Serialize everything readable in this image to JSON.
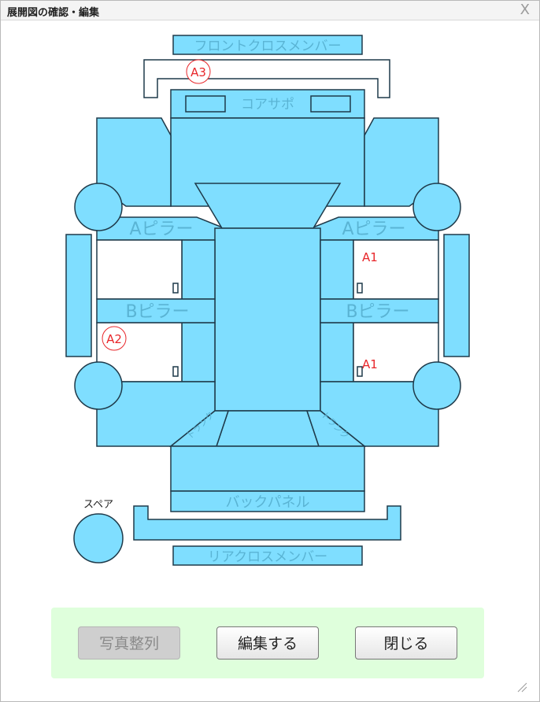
{
  "window": {
    "title": "展開図の確認・編集",
    "close_glyph": "X"
  },
  "panels": {
    "front_cross_member": "フロントクロスメンバー",
    "core_support": "コアサポ",
    "a_pillar_left": "Aピラー",
    "a_pillar_right": "Aピラー",
    "b_pillar_left": "Bピラー",
    "b_pillar_right": "Bピラー",
    "back_panel": "バックパネル",
    "rear_cross_member": "リアクロスメンバー",
    "trunk_left": "トランク",
    "trunk_right": "トランク",
    "spare": "スペア"
  },
  "markers": [
    {
      "label": "A3",
      "circled": true
    },
    {
      "label": "A2",
      "circled": true
    },
    {
      "label": "A1",
      "circled": false
    },
    {
      "label": "A1",
      "circled": false
    }
  ],
  "buttons": {
    "arrange_photos": "写真整列",
    "edit": "編集する",
    "close": "閉じる"
  },
  "colors": {
    "panel_fill": "#7fdeff",
    "panel_stroke": "#1f3a4a",
    "panel_text": "#5ab4d4",
    "marker": "#e8262a",
    "footer_bg": "#dfffdc"
  }
}
